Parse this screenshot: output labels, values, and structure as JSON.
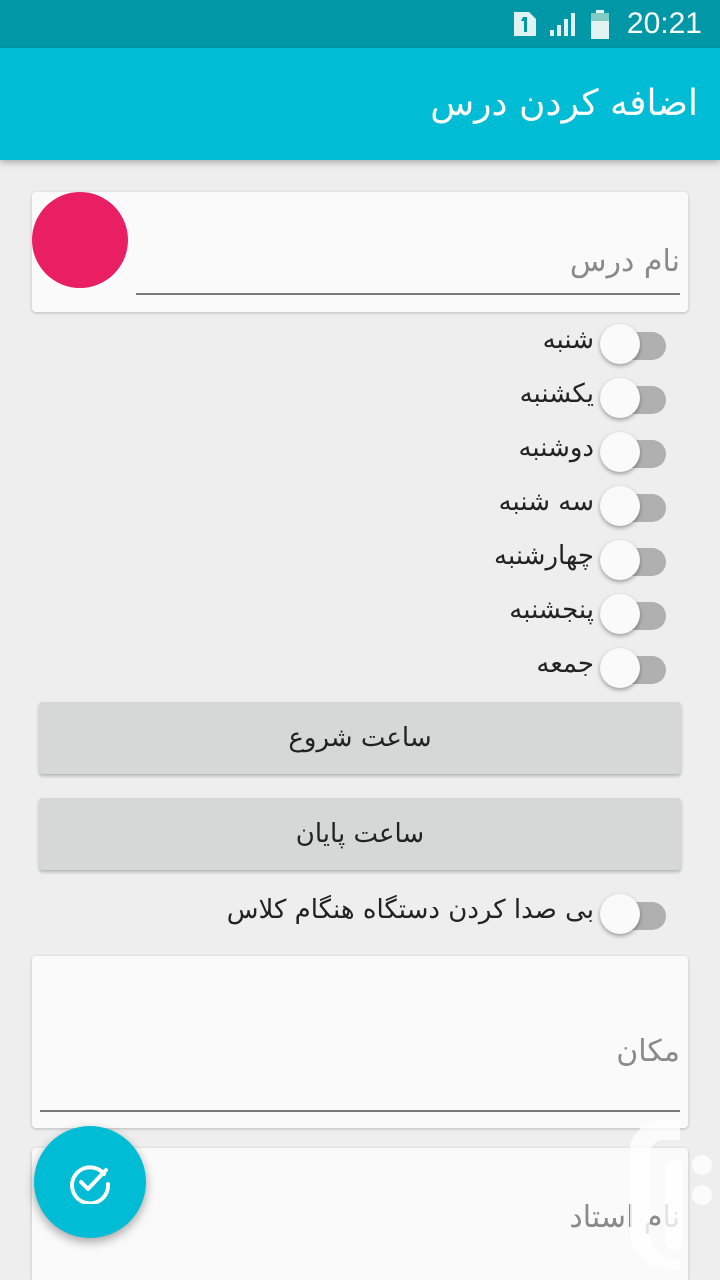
{
  "status_bar": {
    "time": "20:21",
    "icons": [
      "sim-1-icon",
      "signal-icon",
      "battery-icon"
    ]
  },
  "app_bar": {
    "title": "اضافه کردن درس"
  },
  "course_card": {
    "color": "#e91e63",
    "name_placeholder": "نام درس"
  },
  "days": [
    {
      "label": "شنبه",
      "checked": false
    },
    {
      "label": "یکشنبه",
      "checked": false
    },
    {
      "label": "دوشنبه",
      "checked": false
    },
    {
      "label": "سه شنبه",
      "checked": false
    },
    {
      "label": "چهارشنبه",
      "checked": false
    },
    {
      "label": "پنجشنبه",
      "checked": false
    },
    {
      "label": "جمعه",
      "checked": false
    }
  ],
  "buttons": {
    "start_time": "ساعت شروع",
    "end_time": "ساعت پایان"
  },
  "silent_mode": {
    "label": "بی صدا کردن دستگاه هنگام کلاس",
    "checked": false
  },
  "location": {
    "placeholder": "مکان"
  },
  "teacher": {
    "placeholder": "نام استاد"
  },
  "fab": {
    "icon": "check-circle-icon"
  },
  "colors": {
    "status_bar": "#0097a7",
    "app_bar": "#00bcd4",
    "accent": "#e91e63",
    "background": "#eeeeee"
  }
}
